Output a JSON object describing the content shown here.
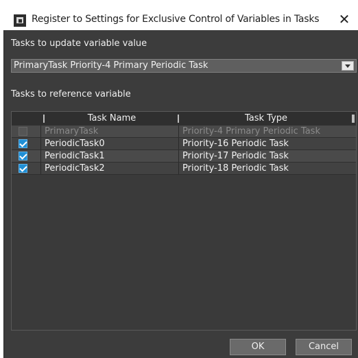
{
  "window": {
    "title": "Register to Settings for Exclusive Control of Variables in Tasks",
    "close_glyph": "✕"
  },
  "update_section": {
    "label": "Tasks to update variable value",
    "selected": "PrimaryTask Priority-4 Primary Periodic Task"
  },
  "reference_section": {
    "label": "Tasks to reference variable",
    "columns": [
      "Task Name",
      "Task Type"
    ],
    "rows": [
      {
        "checked": false,
        "enabled": false,
        "name": "PrimaryTask",
        "type": "Priority-4 Primary Periodic Task"
      },
      {
        "checked": true,
        "enabled": true,
        "name": "PeriodicTask0",
        "type": "Priority-16 Periodic Task"
      },
      {
        "checked": true,
        "enabled": true,
        "name": "PeriodicTask1",
        "type": "Priority-17 Periodic Task"
      },
      {
        "checked": true,
        "enabled": true,
        "name": "PeriodicTask2",
        "type": "Priority-18 Periodic Task"
      }
    ]
  },
  "buttons": {
    "ok": "OK",
    "cancel": "Cancel"
  },
  "colors": {
    "dialog_bg": "#3c3c3c",
    "checkbox_accent": "#1f8fd6"
  }
}
